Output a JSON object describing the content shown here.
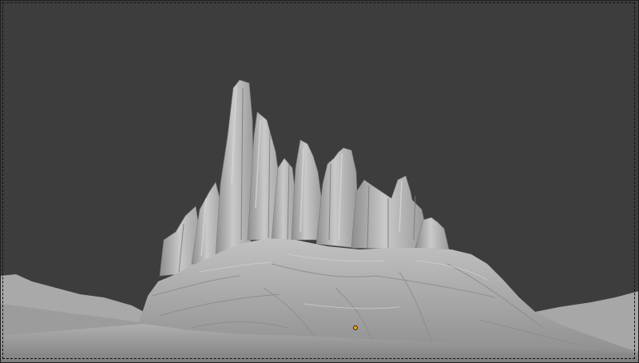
{
  "viewport": {
    "background_color": "#3d3d3d",
    "mesh_color": "#b8b8b8",
    "origin_color": "#f0a020",
    "content": "terrain-mesh"
  }
}
